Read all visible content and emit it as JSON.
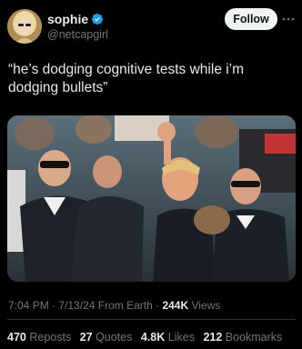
{
  "user": {
    "display_name": "sophie",
    "handle": "@netcapgirl",
    "verified_icon": "verified-badge-icon",
    "verified_color": "#1d9bf0"
  },
  "actions": {
    "follow_label": "Follow",
    "more_icon": "more-horizontal-icon"
  },
  "tweet": {
    "text": "“he’s dodging cognitive tests while i’m dodging bullets”"
  },
  "meta": {
    "time": "7:04 PM",
    "sep1": " · ",
    "date": "7/13/24",
    "source": " From Earth",
    "sep2": " · ",
    "views_count": "244K",
    "views_label": " Views"
  },
  "stats": {
    "reposts_count": "470",
    "reposts_label": "Reposts",
    "quotes_count": "27",
    "quotes_label": "Quotes",
    "likes_count": "4.8K",
    "likes_label": "Likes",
    "bookmarks_count": "212",
    "bookmarks_label": "Bookmarks"
  }
}
